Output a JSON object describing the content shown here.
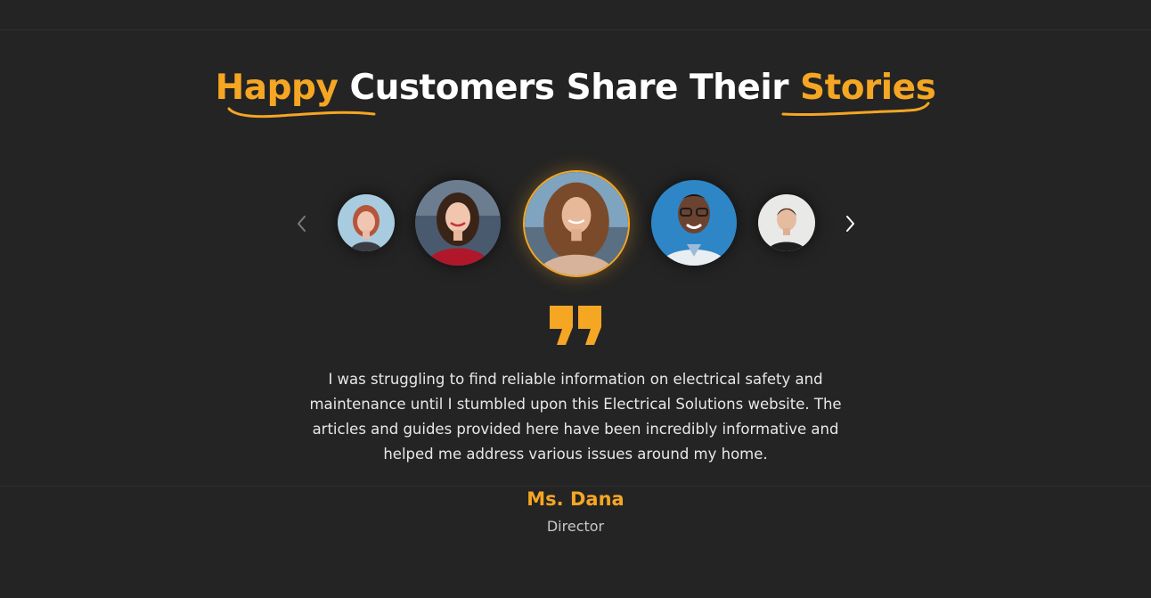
{
  "heading": {
    "accent_1": "Happy",
    "middle": " Customers Share Their ",
    "accent_2": "Stories"
  },
  "carousel": {
    "prev_icon": "chevron-left-icon",
    "next_icon": "chevron-right-icon",
    "avatars": [
      "customer-1-avatar",
      "customer-2-avatar",
      "customer-3-avatar",
      "customer-4-avatar",
      "customer-5-avatar"
    ],
    "active_index": 2
  },
  "testimonial": {
    "quote_icon": "quote-icon",
    "text": "I was struggling to find reliable information on electrical safety and maintenance until I stumbled upon this Electrical Solutions website. The articles and guides provided here have been incredibly informative and helped me address various issues around my home.",
    "name": "Ms. Dana",
    "role": "Director"
  },
  "colors": {
    "background": "#242424",
    "accent": "#f5a623",
    "text": "#e8e8e8"
  }
}
